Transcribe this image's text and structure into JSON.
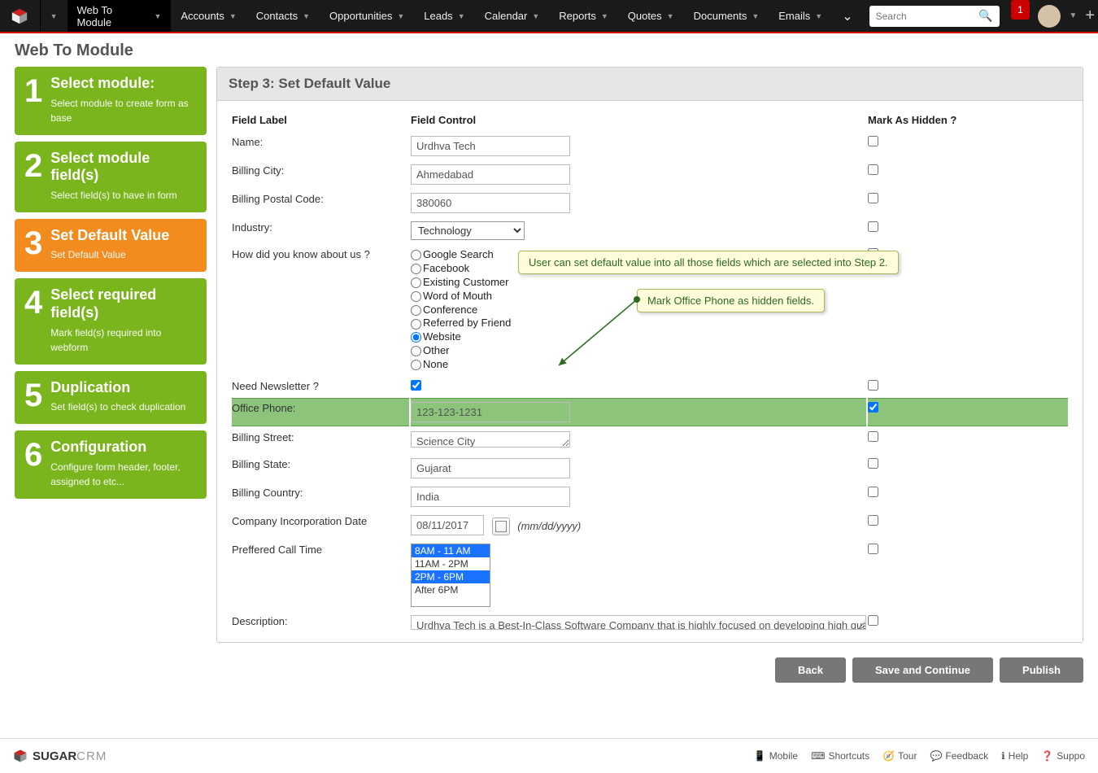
{
  "nav": {
    "items": [
      {
        "label": "Web To Module",
        "active": true
      },
      {
        "label": "Accounts"
      },
      {
        "label": "Contacts"
      },
      {
        "label": "Opportunities"
      },
      {
        "label": "Leads"
      },
      {
        "label": "Calendar"
      },
      {
        "label": "Reports"
      },
      {
        "label": "Quotes"
      },
      {
        "label": "Documents"
      },
      {
        "label": "Emails"
      }
    ],
    "search_placeholder": "Search",
    "notif_count": "1"
  },
  "page_title": "Web To Module",
  "steps": [
    {
      "num": "1",
      "title": "Select module:",
      "desc": "Select module to create form as base"
    },
    {
      "num": "2",
      "title": "Select module field(s)",
      "desc": "Select field(s) to have in form"
    },
    {
      "num": "3",
      "title": "Set Default Value",
      "desc": "Set Default Value",
      "active": true
    },
    {
      "num": "4",
      "title": "Select required field(s)",
      "desc": "Mark field(s) required into webform"
    },
    {
      "num": "5",
      "title": "Duplication",
      "desc": "Set field(s) to check duplication"
    },
    {
      "num": "6",
      "title": "Configuration",
      "desc": "Configure form header, footer, assigned to etc..."
    }
  ],
  "panel": {
    "title": "Step 3: Set Default Value",
    "header_label": "Field Label",
    "header_control": "Field Control",
    "header_hidden": "Mark As Hidden ?"
  },
  "fields": {
    "name": {
      "label": "Name:",
      "value": "Urdhva Tech"
    },
    "billing_city": {
      "label": "Billing City:",
      "value": "Ahmedabad"
    },
    "billing_postal": {
      "label": "Billing Postal Code:",
      "value": "380060"
    },
    "industry": {
      "label": "Industry:",
      "value": "Technology"
    },
    "know_about": {
      "label": "How did you know about us ?",
      "options": [
        "Google Search",
        "Facebook",
        "Existing Customer",
        "Word of Mouth",
        "Conference",
        "Referred by Friend",
        "Website",
        "Other",
        "None"
      ],
      "selected": "Website"
    },
    "newsletter": {
      "label": "Need Newsletter ?",
      "checked": true
    },
    "office_phone": {
      "label": "Office Phone:",
      "value": "123-123-1231",
      "hidden_checked": true
    },
    "billing_street": {
      "label": "Billing Street:",
      "value": "Science City"
    },
    "billing_state": {
      "label": "Billing State:",
      "value": "Gujarat"
    },
    "billing_country": {
      "label": "Billing Country:",
      "value": "India"
    },
    "incorp_date": {
      "label": "Company Incorporation Date",
      "value": "08/11/2017",
      "format": "(mm/dd/yyyy)"
    },
    "call_time": {
      "label": "Preffered Call Time",
      "options": [
        "8AM - 11 AM",
        "11AM - 2PM",
        "2PM - 6PM",
        "After 6PM"
      ],
      "selected": [
        "8AM - 11 AM",
        "2PM - 6PM"
      ]
    },
    "description": {
      "label": "Description:",
      "value": "Urdhva Tech is a Best-In-Class Software Company that is highly focused on developing high quality"
    }
  },
  "callouts": {
    "c1": "User can set default value into all those fields which are selected into Step 2.",
    "c2": "Mark Office Phone as hidden fields."
  },
  "buttons": {
    "back": "Back",
    "save": "Save and Continue",
    "publish": "Publish"
  },
  "footer": {
    "brand_a": "SUGAR",
    "brand_b": "CRM",
    "links": [
      "Mobile",
      "Shortcuts",
      "Tour",
      "Feedback",
      "Help",
      "Suppo"
    ]
  }
}
